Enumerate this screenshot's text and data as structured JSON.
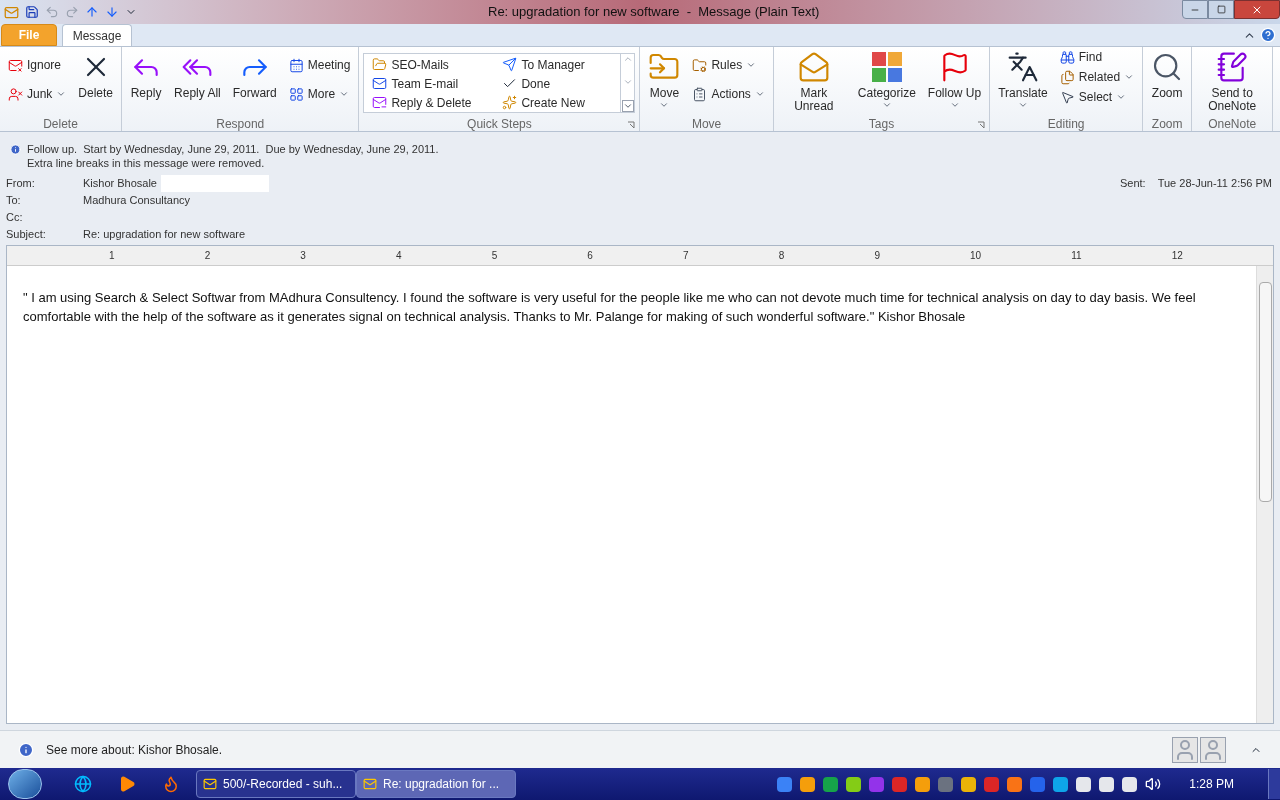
{
  "window": {
    "title": "Re: upgradation for new software  -  Message (Plain Text)"
  },
  "tabs": [
    {
      "label": "File",
      "kind": "file",
      "selected": false
    },
    {
      "label": "Message",
      "kind": "tab",
      "selected": true
    }
  ],
  "ribbon": [
    {
      "label": "Delete",
      "kind": "standard",
      "launcher": false,
      "columns": [
        [
          {
            "label": "Ignore",
            "kind": "small",
            "dropdown": false
          },
          {
            "label": "Junk",
            "kind": "small",
            "dropdown": true
          }
        ],
        [
          {
            "label": "Delete",
            "kind": "large",
            "dropdown": false
          }
        ]
      ]
    },
    {
      "label": "Respond",
      "kind": "standard",
      "launcher": false,
      "columns": [
        [
          {
            "label": "Reply",
            "kind": "large",
            "dropdown": false
          }
        ],
        [
          {
            "label": "Reply All",
            "kind": "large",
            "dropdown": false
          }
        ],
        [
          {
            "label": "Forward",
            "kind": "large",
            "dropdown": false
          }
        ],
        [
          {
            "label": "Meeting",
            "kind": "small",
            "dropdown": false
          },
          {
            "label": "More",
            "kind": "small",
            "dropdown": true
          }
        ]
      ]
    },
    {
      "label": "Quick Steps",
      "kind": "gallery",
      "launcher": true,
      "columns": [
        [
          {
            "label": "SEO-Mails",
            "kind": "small",
            "dropdown": false
          },
          {
            "label": "Team E-mail",
            "kind": "small",
            "dropdown": false
          },
          {
            "label": "Reply & Delete",
            "kind": "small",
            "dropdown": false
          }
        ],
        [
          {
            "label": "To Manager",
            "kind": "small",
            "dropdown": false
          },
          {
            "label": "Done",
            "kind": "small",
            "dropdown": false
          },
          {
            "label": "Create New",
            "kind": "small",
            "dropdown": false
          }
        ]
      ]
    },
    {
      "label": "Move",
      "kind": "standard",
      "launcher": false,
      "columns": [
        [
          {
            "label": "Move",
            "kind": "large",
            "dropdown": true
          }
        ],
        [
          {
            "label": "Rules",
            "kind": "small",
            "dropdown": true
          },
          {
            "label": "Actions",
            "kind": "small",
            "dropdown": true
          }
        ]
      ]
    },
    {
      "label": "Tags",
      "kind": "standard",
      "launcher": true,
      "columns": [
        [
          {
            "label": "Mark Unread",
            "kind": "large",
            "dropdown": false
          }
        ],
        [
          {
            "label": "Categorize",
            "kind": "large",
            "dropdown": true
          }
        ],
        [
          {
            "label": "Follow Up",
            "kind": "large",
            "dropdown": true
          }
        ]
      ]
    },
    {
      "label": "Editing",
      "kind": "standard",
      "launcher": false,
      "columns": [
        [
          {
            "label": "Translate",
            "kind": "large",
            "dropdown": true
          }
        ],
        [
          {
            "label": "Find",
            "kind": "small",
            "dropdown": false
          },
          {
            "label": "Related",
            "kind": "small",
            "dropdown": true
          },
          {
            "label": "Select",
            "kind": "small",
            "dropdown": true
          }
        ]
      ]
    },
    {
      "label": "Zoom",
      "kind": "standard",
      "launcher": false,
      "columns": [
        [
          {
            "label": "Zoom",
            "kind": "large",
            "dropdown": false
          }
        ]
      ]
    },
    {
      "label": "OneNote",
      "kind": "standard",
      "launcher": false,
      "columns": [
        [
          {
            "label": "Send to OneNote",
            "kind": "large",
            "dropdown": false
          }
        ]
      ]
    }
  ],
  "infobar": [
    "Follow up.  Start by Wednesday, June 29, 2011.  Due by Wednesday, June 29, 2011.",
    "Extra line breaks in this message were removed."
  ],
  "header": {
    "fields": [
      {
        "label": "From:",
        "value": "Kishor Bhosale"
      },
      {
        "label": "To:",
        "value": "Madhura Consultancy"
      },
      {
        "label": "Cc:"
      },
      {
        "label": "Subject:",
        "value": "Re: upgradation for new software"
      }
    ],
    "sent": {
      "label": "Sent:",
      "value": "Tue 28-Jun-11 2:56 PM"
    }
  },
  "ruler": [
    "1",
    "2",
    "3",
    "4",
    "5",
    "6",
    "7",
    "8",
    "9",
    "10",
    "11",
    "12"
  ],
  "body": "\" I am using Search  & Select Softwar from MAdhura Consultency. I found the software is very useful for the people like me who can not devote much time for technical analysis on day to day basis. We feel comfortable with the help of the software as it generates signal on technical analysis. Thanks to Mr. Palange for making of such wonderful software.\" Kishor Bhosale",
  "people_pane": {
    "text": "See more about: Kishor Bhosale."
  },
  "taskbar": {
    "windows": [
      {
        "label": "500/-Recorded - suh...",
        "selected": false
      },
      {
        "label": "Re: upgradation for ...",
        "selected": true
      }
    ],
    "clock": "1:28 PM"
  }
}
